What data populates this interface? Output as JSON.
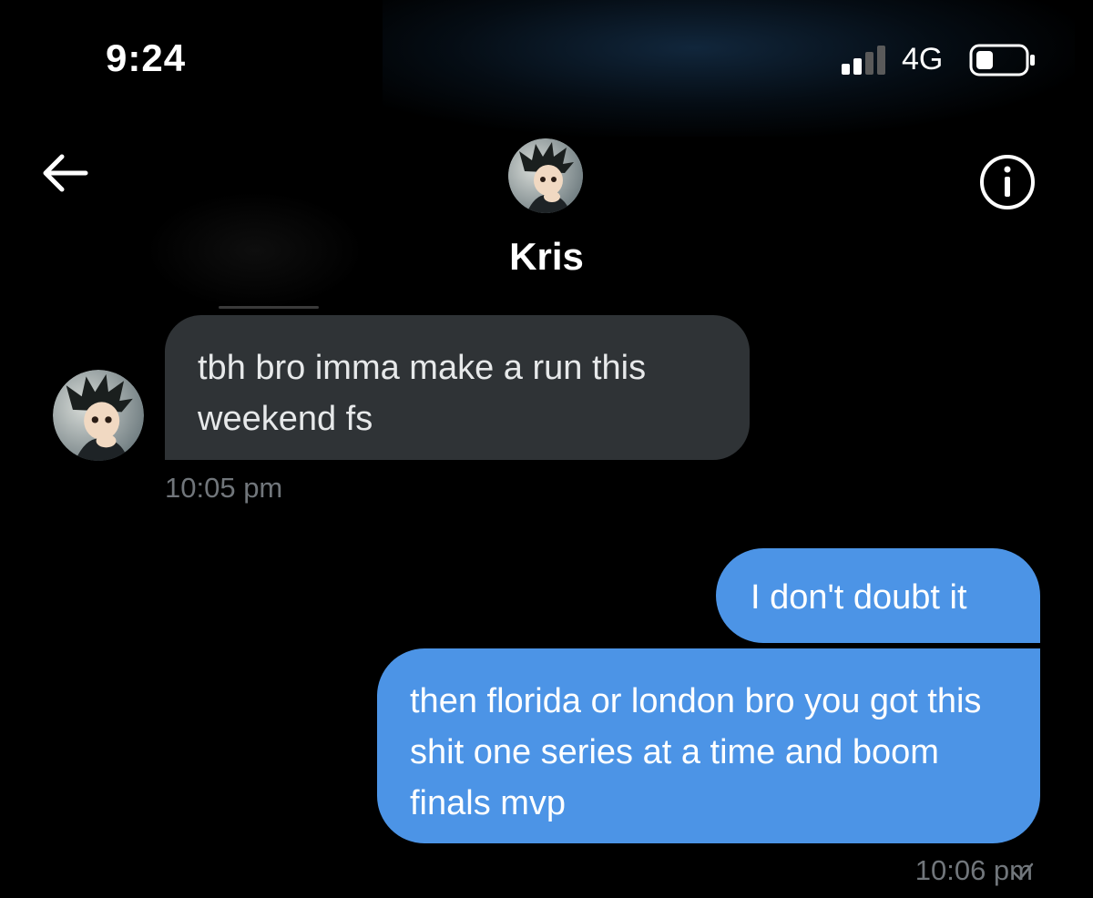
{
  "status_bar": {
    "time": "9:24",
    "network": "4G",
    "signal_bars_active": 2,
    "signal_bars_total": 4,
    "signal_icon": "cellular-signal-icon",
    "battery_icon": "battery-icon",
    "battery_level": 0.3
  },
  "header": {
    "back_icon": "back-arrow-icon",
    "contact_name": "Kris",
    "info_icon": "info-icon",
    "avatar": "contact-avatar"
  },
  "messages": [
    {
      "direction": "incoming",
      "text": "tbh bro imma make a run this weekend fs",
      "time": "10:05 pm"
    },
    {
      "direction": "outgoing",
      "text": "I don't doubt it"
    },
    {
      "direction": "outgoing",
      "text": "then florida or london bro you got this shit one series at a time and boom finals mvp",
      "time": "10:06 pm",
      "status_icon": "sent-check-icon"
    }
  ],
  "colors": {
    "background": "#000000",
    "incoming_bubble": "#2f3336",
    "outgoing_bubble": "#4c94e6",
    "timestamp": "#71767b"
  }
}
